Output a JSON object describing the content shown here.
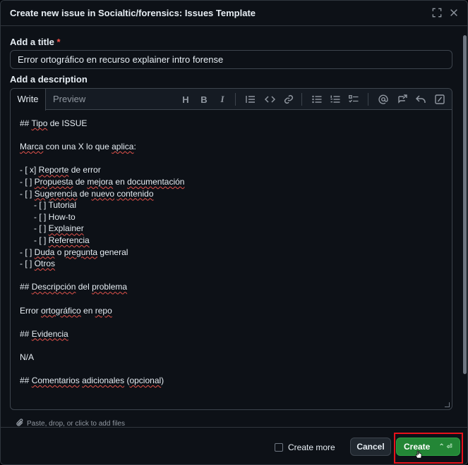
{
  "header": {
    "title": "Create new issue in Socialtic/forensics: Issues Template"
  },
  "form": {
    "title_label": "Add a title",
    "required_mark": "*",
    "title_value": "Error ortográfico en recurso explainer intro forense",
    "description_label": "Add a description"
  },
  "editor": {
    "tabs": [
      {
        "label": "Write"
      },
      {
        "label": "Preview"
      }
    ],
    "toolbar_icons": [
      "heading-icon",
      "bold-icon",
      "italic-icon",
      "quote-icon",
      "code-icon",
      "link-icon",
      "unordered-list-icon",
      "ordered-list-icon",
      "task-list-icon",
      "mention-icon",
      "cross-reference-icon",
      "saved-reply-icon",
      "slash-command-icon"
    ],
    "lines": [
      "## Tipo de ISSUE",
      "",
      "Marca con una X lo que aplica:",
      "",
      "- [ x] Reporte de error",
      "- [ ] Propuesta de mejora en documentación",
      "- [ ] Sugerencia de nuevo contenido",
      "      - [ ] Tutorial",
      "      - [ ] How-to",
      "      - [ ] Explainer",
      "      - [ ] Referencia",
      "- [ ] Duda o pregunta general",
      "- [ ] Otros",
      "",
      "## Descripción del problema",
      "",
      "Error ortográfico en repo",
      "",
      "## Evidencia",
      "",
      "N/A",
      "",
      "## Comentarios adicionales (opcional)"
    ]
  },
  "attach_hint": "Paste, drop, or click to add files",
  "footer": {
    "create_more_label": "Create more",
    "cancel_label": "Cancel",
    "create_label": "Create",
    "create_shortcut": "⌃ ⏎"
  },
  "colors": {
    "accent_green": "#238636",
    "highlight_red": "#e8111a",
    "background": "#0d1117"
  }
}
